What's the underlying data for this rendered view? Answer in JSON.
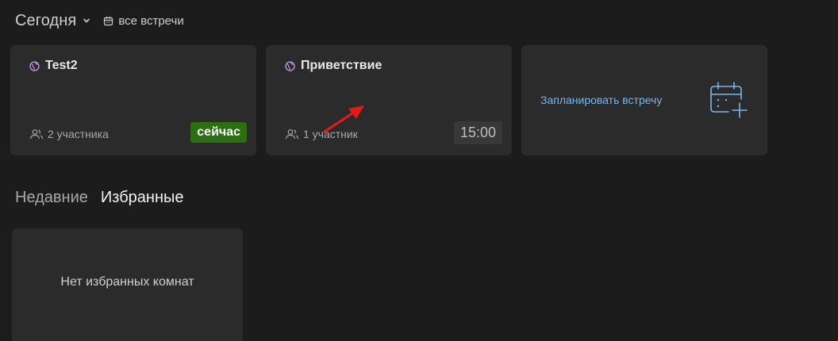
{
  "header": {
    "title": "Сегодня",
    "all_meetings_label": "все встречи"
  },
  "meetings": [
    {
      "name": "Test2",
      "participants": "2 участника",
      "status": "сейчас"
    },
    {
      "name": "Приветствие",
      "participants": "1 участник",
      "time": "15:00"
    }
  ],
  "schedule": {
    "label": "Запланировать встречу"
  },
  "tabs": [
    {
      "label": "Недавние",
      "active": false
    },
    {
      "label": "Избранные",
      "active": true
    }
  ],
  "favorites": {
    "empty_text": "Нет избранных комнат"
  },
  "colors": {
    "background": "#1c1c1c",
    "card": "#2b2b2b",
    "accent_blue": "#7ab6ee",
    "now_badge": "#2c6e12",
    "annotation_arrow": "#e0191b"
  },
  "icons": {
    "chevron": "chevron-down-icon",
    "calendar_small": "calendar-icon",
    "room": "globe-icon",
    "participants": "people-icon",
    "schedule": "calendar-add-icon"
  }
}
